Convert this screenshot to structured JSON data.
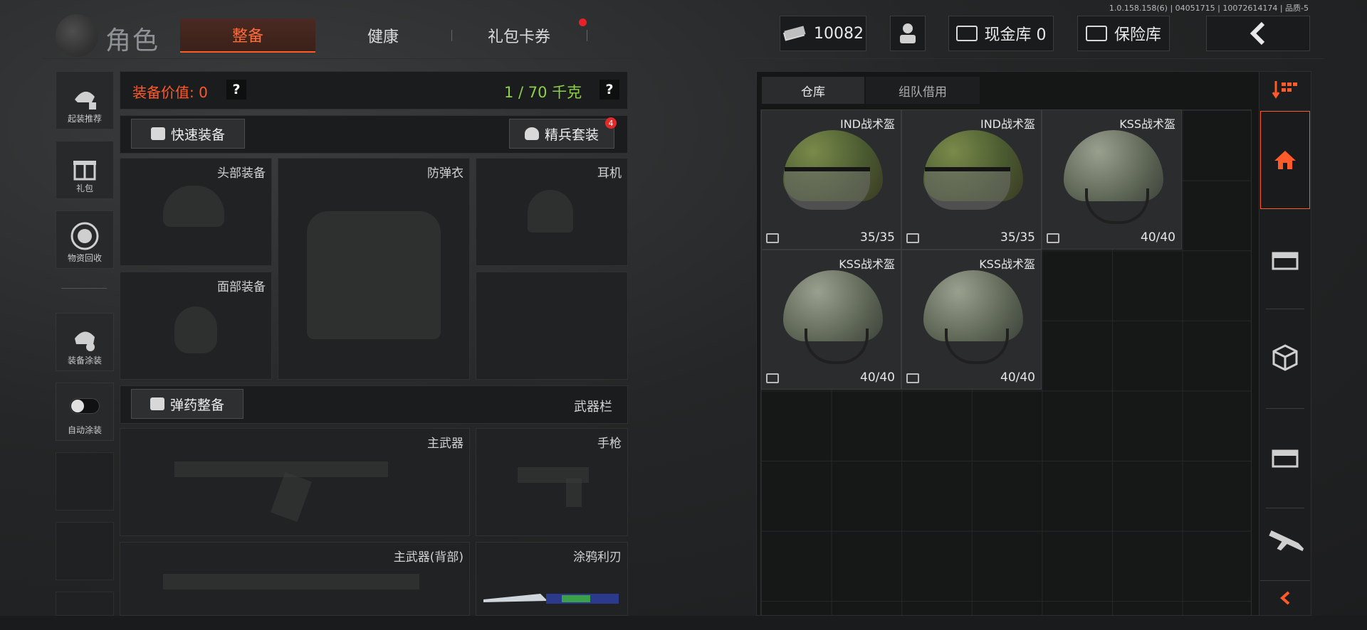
{
  "version": "1.0.158.158(6) | 04051715 | 10072614174 | 品质-5",
  "header": {
    "title": "角色",
    "tabs": [
      {
        "label": "整备",
        "active": true
      },
      {
        "label": "健康",
        "active": false
      },
      {
        "label": "礼包卡券",
        "active": false,
        "has_dot": true
      }
    ],
    "currency": "10082",
    "cash_vault": "现金库 0",
    "safe": "保险库"
  },
  "sidebar": {
    "items": [
      {
        "label": "起装推荐",
        "icon": "recommend-icon"
      },
      {
        "label": "礼包",
        "icon": "gift-icon"
      },
      {
        "label": "物资回收",
        "icon": "recycle-icon"
      },
      {
        "label": "装备涂装",
        "icon": "paint-icon"
      },
      {
        "label": "自动涂装",
        "icon": "toggle-icon"
      }
    ]
  },
  "equipment": {
    "value_label": "装备价值: 0",
    "weight_label": "1 / 70 千克",
    "help": "?",
    "quick_equip": "快速装备",
    "elite_kit": "精兵套装",
    "elite_badge": "4",
    "slots": {
      "head": "头部装备",
      "armor": "防弹衣",
      "headset": "耳机",
      "face": "面部装备"
    },
    "ammo_button": "弹药整备",
    "weapon_bar": "武器栏",
    "weapon_slots": {
      "primary": "主武器",
      "pistol": "手枪",
      "primary_back": "主武器(背部)",
      "melee": "涂鸦利刃"
    }
  },
  "storage": {
    "tabs": [
      {
        "label": "仓库",
        "active": true
      },
      {
        "label": "组队借用",
        "active": false
      }
    ],
    "items": [
      {
        "name": "IND战术盔",
        "durability": "35/35",
        "camo": true
      },
      {
        "name": "IND战术盔",
        "durability": "35/35",
        "camo": true
      },
      {
        "name": "KSS战术盔",
        "durability": "40/40",
        "camo": false
      },
      {
        "name": "KSS战术盔",
        "durability": "40/40",
        "camo": false
      },
      {
        "name": "KSS战术盔",
        "durability": "40/40",
        "camo": false
      }
    ]
  },
  "colors": {
    "accent": "#ff5a2a",
    "weight_ok": "#8ed04a"
  }
}
